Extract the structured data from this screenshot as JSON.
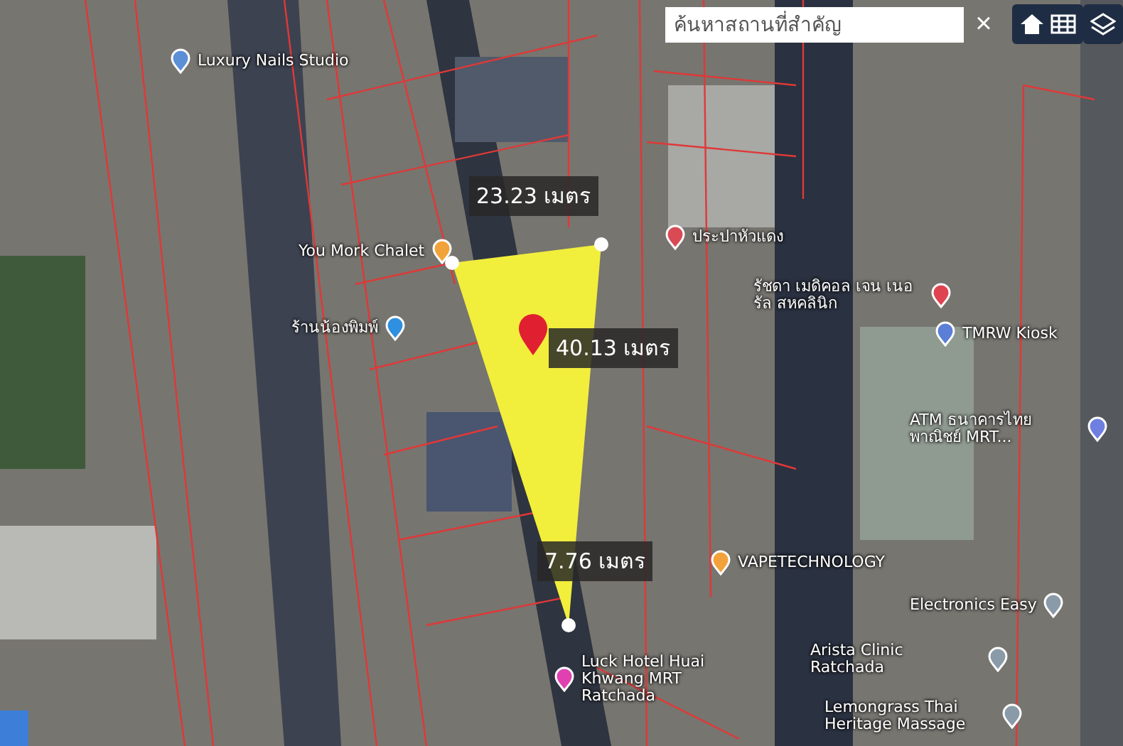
{
  "search": {
    "placeholder": "ค้นหาสถานที่สำคัญ",
    "close": "×"
  },
  "parcel": {
    "selected": true,
    "color": "#f2ee3c"
  },
  "measurements": [
    "23.23 เมตร",
    "40.13 เมตร",
    "7.76 เมตร"
  ],
  "places": [
    {
      "label": "Luxury Nails Studio",
      "color": "#5b8fd6"
    },
    {
      "label": "You Mork Chalet",
      "color": "#f2a23a"
    },
    {
      "label": "ร้านน้องพิมพ์",
      "color": "#2f8fe0"
    },
    {
      "label": "ประปาหัวแดง",
      "color": "#d94a55"
    },
    {
      "label": "รัชดา เมดิคอล เจน เนอรัล สหคลินิก",
      "color": "#e04350"
    },
    {
      "label": "TMRW Kiosk",
      "color": "#5b7fd6"
    },
    {
      "label": "ATM ธนาคารไทย พาณิชย์ MRT...",
      "color": "#6f7fe0"
    },
    {
      "label": "VAPETECHNOLOGY",
      "color": "#f2a23a"
    },
    {
      "label": "Electronics Easy",
      "color": "#8a9aa8"
    },
    {
      "label": "Arista Clinic Ratchada",
      "color": "#8a9aa8"
    },
    {
      "label": "Lemongrass Thai Heritage Massage",
      "color": "#8a9aa8"
    },
    {
      "label": "Luck Hotel Huai Khwang MRT Ratchada",
      "color": "#e040b0"
    }
  ]
}
